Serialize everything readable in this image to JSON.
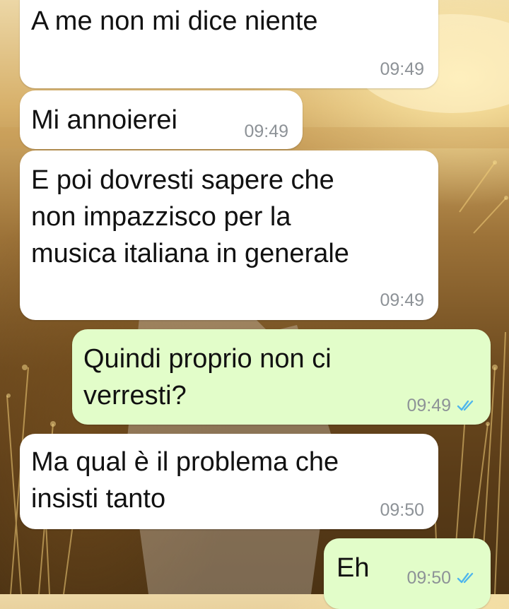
{
  "messages": [
    {
      "direction": "incoming",
      "lines": [
        "A me non mi dice niente"
      ],
      "time": "09:49"
    },
    {
      "direction": "incoming",
      "lines": [
        "Mi annoierei"
      ],
      "time": "09:49"
    },
    {
      "direction": "incoming",
      "lines": [
        "E poi dovresti sapere che",
        "non impazzisco per la",
        "musica italiana in generale"
      ],
      "time": "09:49"
    },
    {
      "direction": "outgoing",
      "lines": [
        "Quindi proprio non ci",
        "verresti?"
      ],
      "time": "09:49",
      "status": "read",
      "status_icon": "double-check-icon"
    },
    {
      "direction": "incoming",
      "lines": [
        "Ma qual è il problema che",
        "insisti tanto"
      ],
      "time": "09:50"
    },
    {
      "direction": "outgoing",
      "lines": [
        "Eh"
      ],
      "time": "09:50",
      "status": "read",
      "status_icon": "double-check-icon"
    }
  ],
  "colors": {
    "incoming_bubble": "#ffffff",
    "outgoing_bubble": "#e2fdc9",
    "timestamp": "#8d9297",
    "read_ticks": "#4fb6ec"
  }
}
